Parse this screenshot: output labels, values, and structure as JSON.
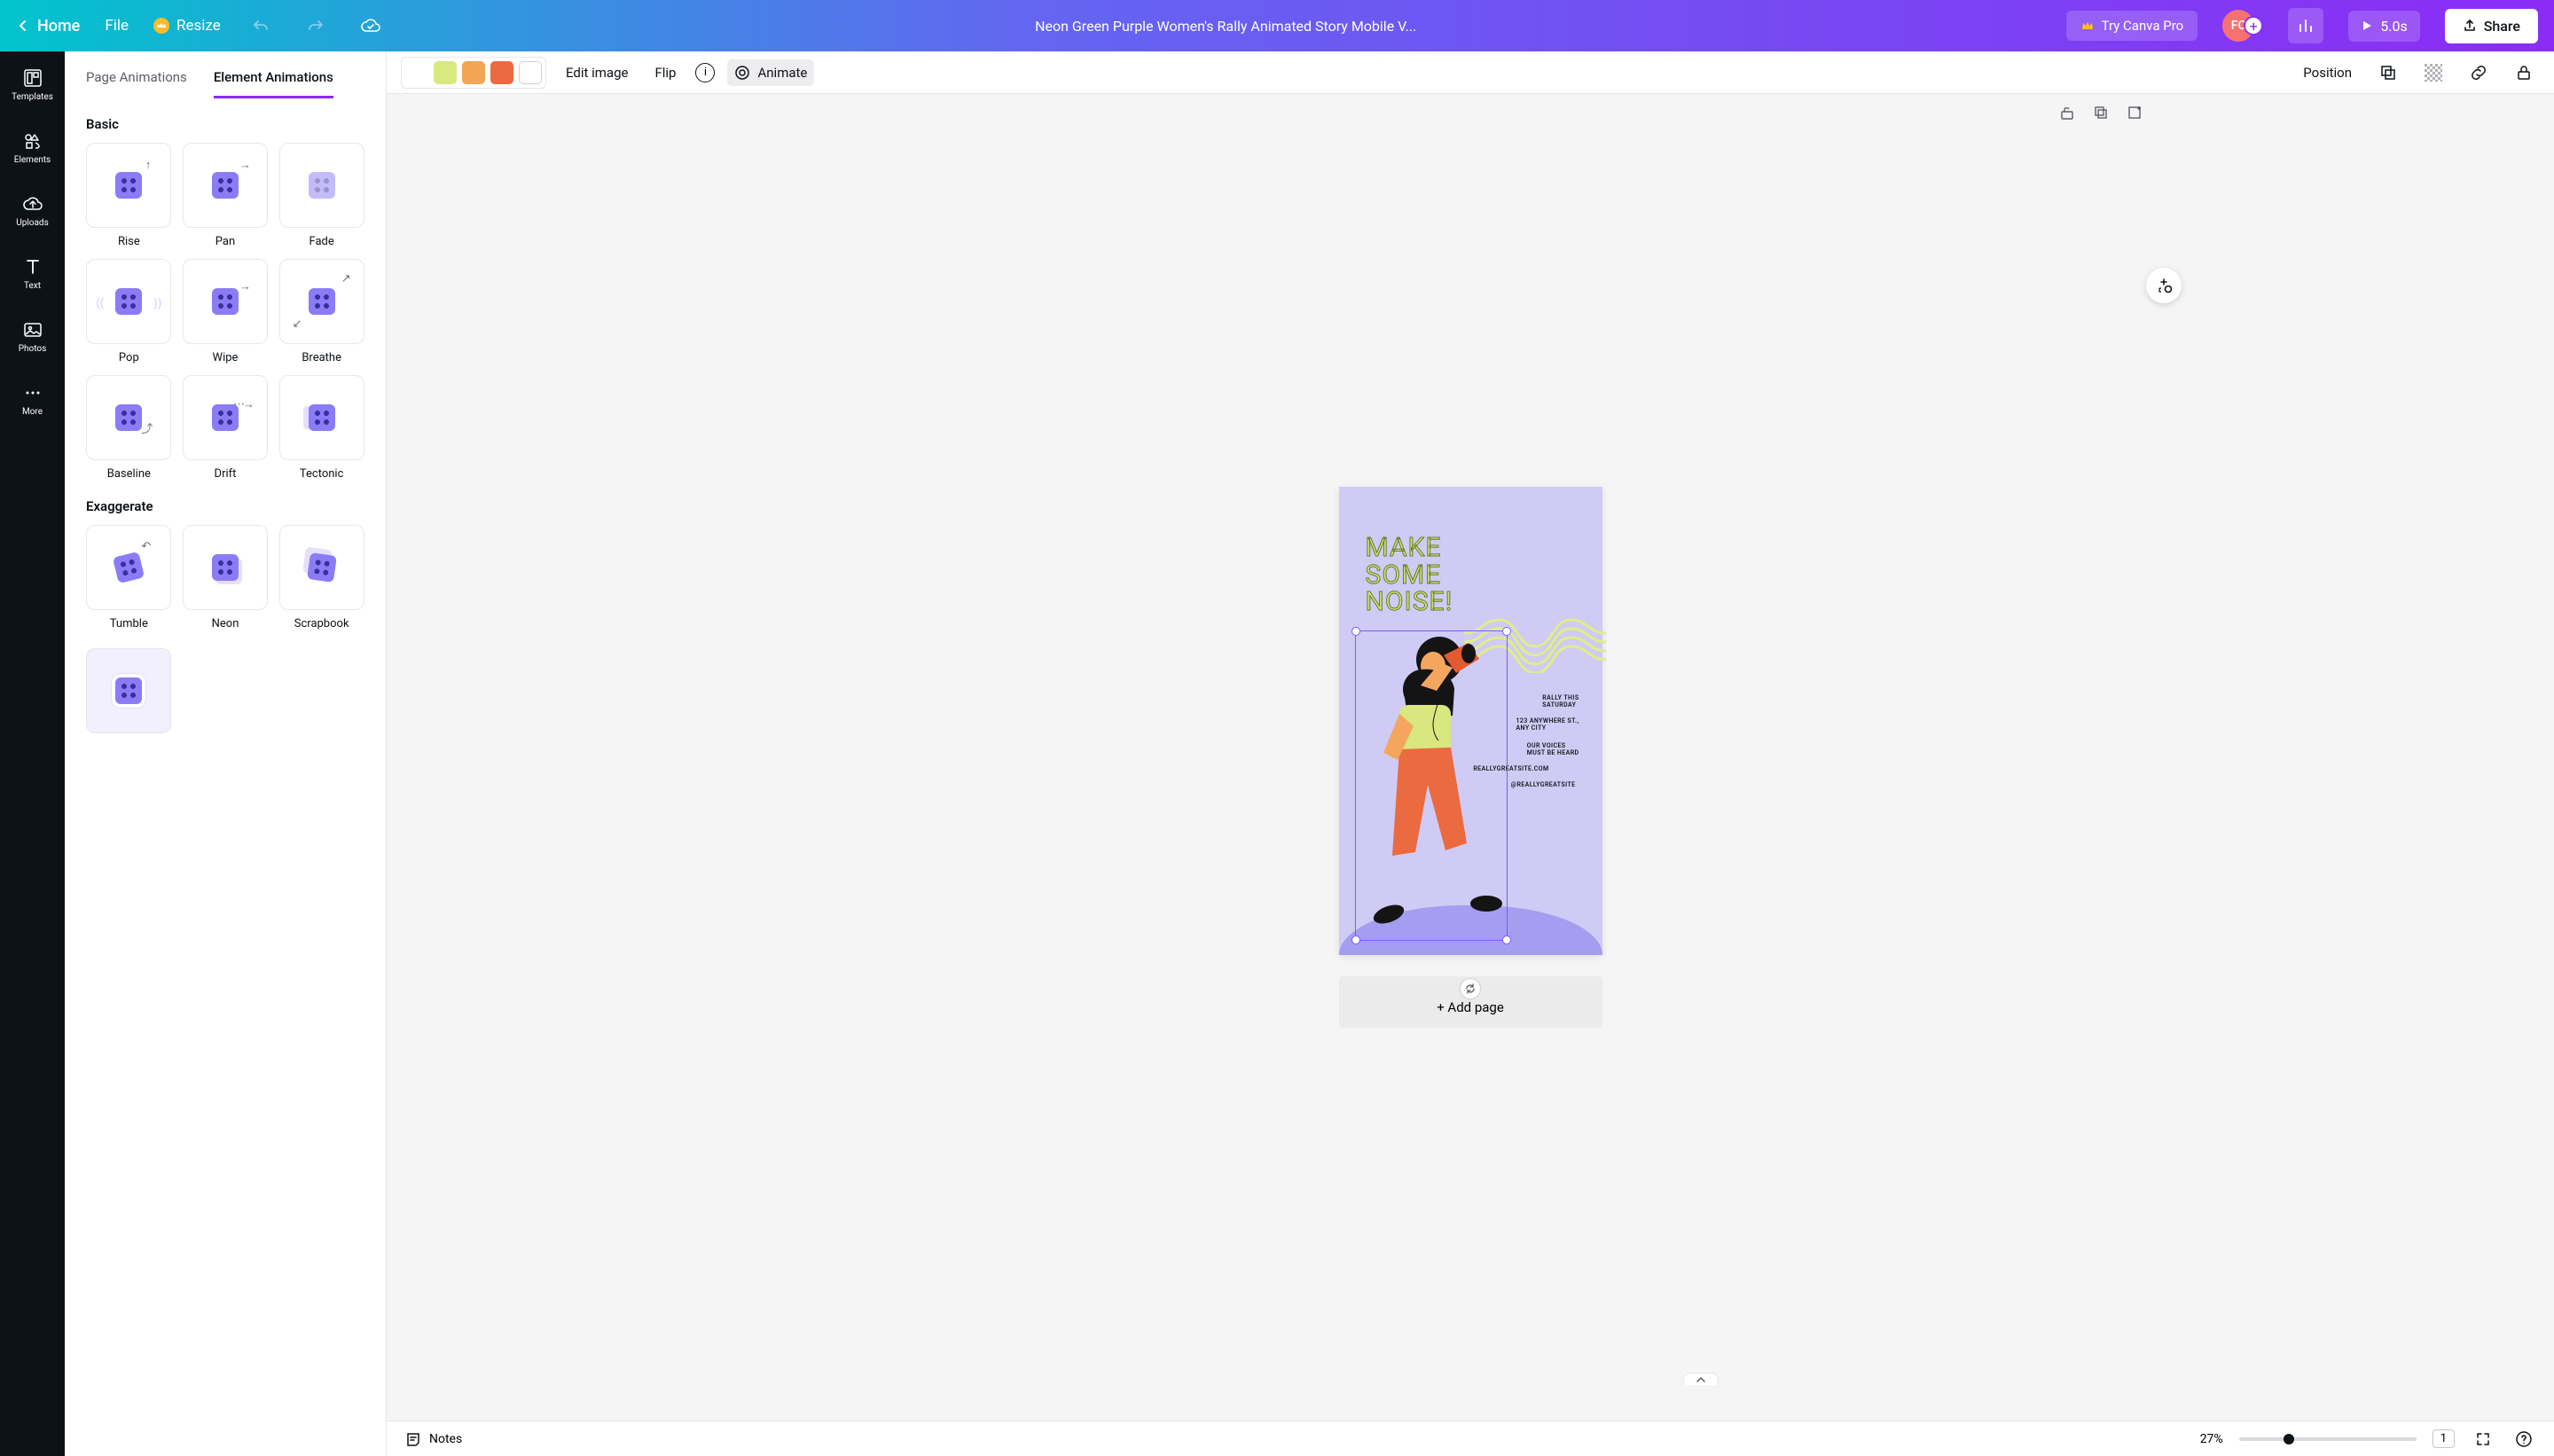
{
  "topbar": {
    "home": "Home",
    "file": "File",
    "resize": "Resize",
    "title": "Neon Green Purple Women's Rally Animated Story Mobile V...",
    "try_pro": "Try Canva Pro",
    "avatar_initials": "FC",
    "duration": "5.0s",
    "share": "Share"
  },
  "nav_rail": {
    "templates": "Templates",
    "elements": "Elements",
    "uploads": "Uploads",
    "text": "Text",
    "photos": "Photos",
    "more": "More"
  },
  "panel": {
    "tab_page": "Page Animations",
    "tab_element": "Element Animations",
    "section_basic": "Basic",
    "section_exaggerate": "Exaggerate",
    "animations_basic": [
      "Rise",
      "Pan",
      "Fade",
      "Pop",
      "Wipe",
      "Breathe",
      "Baseline",
      "Drift",
      "Tectonic"
    ],
    "animations_exaggerate": [
      "Tumble",
      "Neon",
      "Scrapbook"
    ]
  },
  "editor_toolbar": {
    "colors": [
      "#000000",
      "#d9e982",
      "#f2a555",
      "#ec6a3f",
      "#ffffff"
    ],
    "edit_image": "Edit image",
    "flip": "Flip",
    "animate": "Animate",
    "position": "Position"
  },
  "canvas": {
    "headline_l1": "MAKE",
    "headline_l2": "SOME",
    "headline_l3": "NOISE!",
    "sub1": "RALLY THIS\nSATURDAY",
    "sub2": "123 ANYWHERE ST.,\nANY CITY",
    "sub3": "OUR VOICES\nMUST BE HEARD",
    "sub4": "REALLYGREATSITE.COM",
    "sub5": "@REALLYGREATSITE",
    "add_page": "+ Add page"
  },
  "footer": {
    "notes": "Notes",
    "zoom": "27%",
    "page_num": "1"
  }
}
